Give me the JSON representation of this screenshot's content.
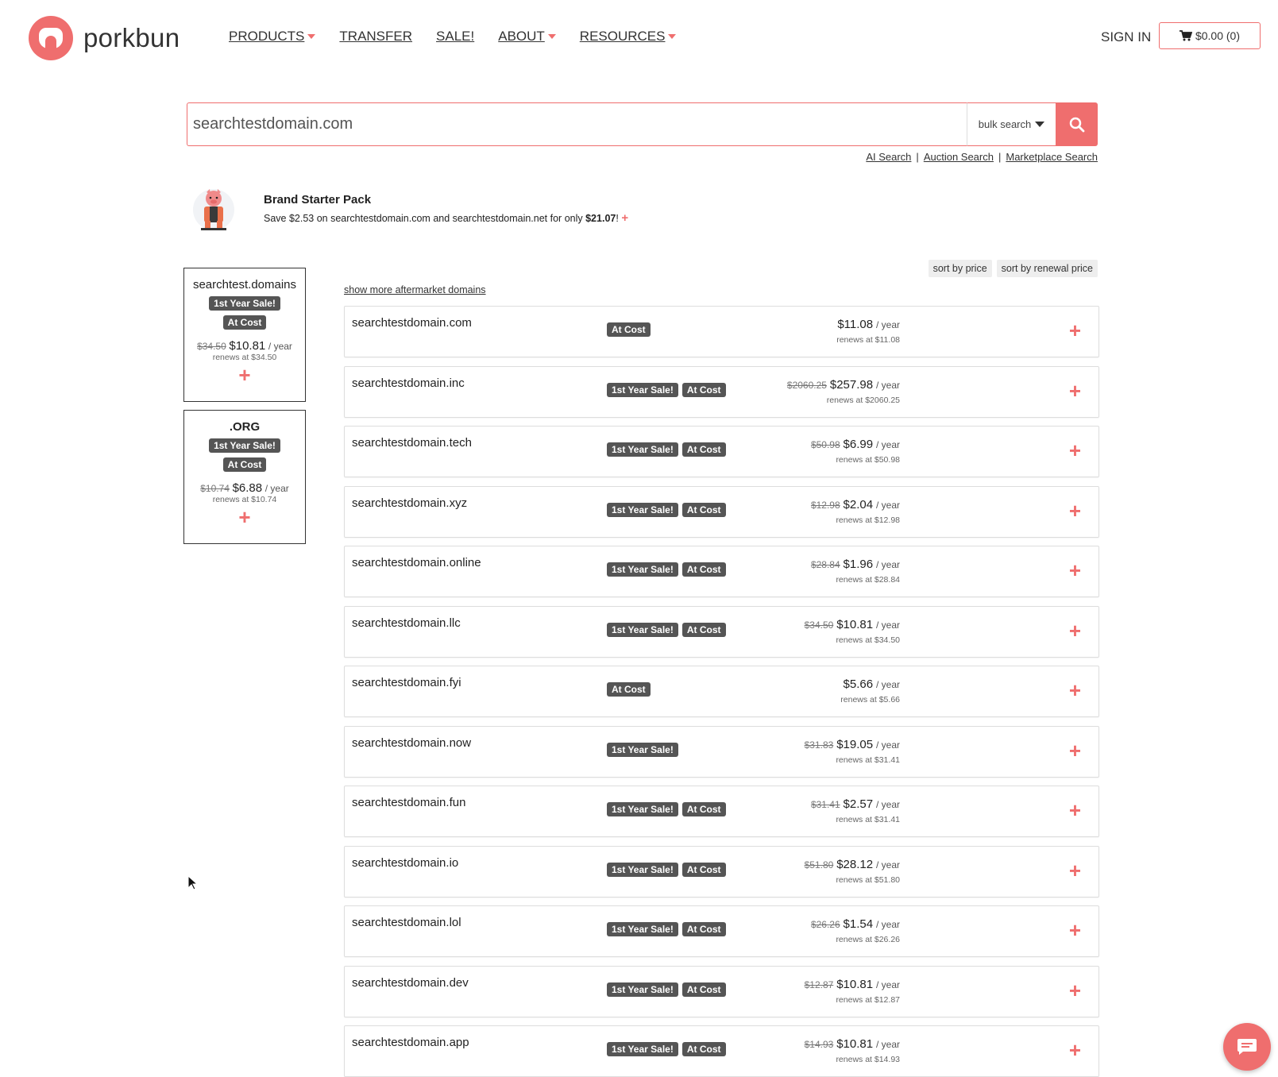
{
  "header": {
    "logo_text": "porkbun",
    "nav": [
      {
        "label": "PRODUCTS",
        "caret": true
      },
      {
        "label": "TRANSFER",
        "caret": false
      },
      {
        "label": "SALE!",
        "caret": false
      },
      {
        "label": "ABOUT",
        "caret": true
      },
      {
        "label": "RESOURCES",
        "caret": true
      }
    ],
    "sign_in": "SIGN IN",
    "cart": "$0.00 (0)"
  },
  "search": {
    "value": "searchtestdomain.com",
    "bulk_label": "bulk search",
    "links": [
      "AI Search",
      "Auction Search",
      "Marketplace Search"
    ],
    "separator": "|"
  },
  "brand_pack": {
    "title": "Brand Starter Pack",
    "desc_prefix": "Save $2.53 on searchtestdomain.com and searchtestdomain.net for only ",
    "price": "$21.07",
    "desc_suffix": "!",
    "plus": "+"
  },
  "sidebar": [
    {
      "name": "searchtest.domains",
      "badges": [
        "1st Year Sale!",
        "At Cost"
      ],
      "old_price": "$34.50",
      "price": "$10.81",
      "per": "/ year",
      "renews": "renews at $34.50",
      "plus": "+"
    },
    {
      "name": ".ORG",
      "badges": [
        "1st Year Sale!",
        "At Cost"
      ],
      "old_price": "$10.74",
      "price": "$6.88",
      "per": "/ year",
      "renews": "renews at $10.74",
      "plus": "+"
    }
  ],
  "sort": {
    "by_price": "sort by price",
    "by_renewal": "sort by renewal price"
  },
  "more_link": "show more aftermarket domains",
  "results": [
    {
      "domain": "searchtestdomain.com",
      "badges": [
        "At Cost"
      ],
      "old_price": "",
      "price": "$11.08",
      "per": "/ year",
      "renews": "renews at $11.08"
    },
    {
      "domain": "searchtestdomain.inc",
      "badges": [
        "1st Year Sale!",
        "At Cost"
      ],
      "old_price": "$2060.25",
      "price": "$257.98",
      "per": "/ year",
      "renews": "renews at $2060.25"
    },
    {
      "domain": "searchtestdomain.tech",
      "badges": [
        "1st Year Sale!",
        "At Cost"
      ],
      "old_price": "$50.98",
      "price": "$6.99",
      "per": "/ year",
      "renews": "renews at $50.98"
    },
    {
      "domain": "searchtestdomain.xyz",
      "badges": [
        "1st Year Sale!",
        "At Cost"
      ],
      "old_price": "$12.98",
      "price": "$2.04",
      "per": "/ year",
      "renews": "renews at $12.98"
    },
    {
      "domain": "searchtestdomain.online",
      "badges": [
        "1st Year Sale!",
        "At Cost"
      ],
      "old_price": "$28.84",
      "price": "$1.96",
      "per": "/ year",
      "renews": "renews at $28.84"
    },
    {
      "domain": "searchtestdomain.llc",
      "badges": [
        "1st Year Sale!",
        "At Cost"
      ],
      "old_price": "$34.50",
      "price": "$10.81",
      "per": "/ year",
      "renews": "renews at $34.50"
    },
    {
      "domain": "searchtestdomain.fyi",
      "badges": [
        "At Cost"
      ],
      "old_price": "",
      "price": "$5.66",
      "per": "/ year",
      "renews": "renews at $5.66"
    },
    {
      "domain": "searchtestdomain.now",
      "badges": [
        "1st Year Sale!"
      ],
      "old_price": "$31.83",
      "price": "$19.05",
      "per": "/ year",
      "renews": "renews at $31.41"
    },
    {
      "domain": "searchtestdomain.fun",
      "badges": [
        "1st Year Sale!",
        "At Cost"
      ],
      "old_price": "$31.41",
      "price": "$2.57",
      "per": "/ year",
      "renews": "renews at $31.41"
    },
    {
      "domain": "searchtestdomain.io",
      "badges": [
        "1st Year Sale!",
        "At Cost"
      ],
      "old_price": "$51.80",
      "price": "$28.12",
      "per": "/ year",
      "renews": "renews at $51.80"
    },
    {
      "domain": "searchtestdomain.lol",
      "badges": [
        "1st Year Sale!",
        "At Cost"
      ],
      "old_price": "$26.26",
      "price": "$1.54",
      "per": "/ year",
      "renews": "renews at $26.26"
    },
    {
      "domain": "searchtestdomain.dev",
      "badges": [
        "1st Year Sale!",
        "At Cost"
      ],
      "old_price": "$12.87",
      "price": "$10.81",
      "per": "/ year",
      "renews": "renews at $12.87"
    },
    {
      "domain": "searchtestdomain.app",
      "badges": [
        "1st Year Sale!",
        "At Cost"
      ],
      "old_price": "$14.93",
      "price": "$10.81",
      "per": "/ year",
      "renews": "renews at $14.93"
    }
  ],
  "add_symbol": "+",
  "colors": {
    "accent": "#ef6e6e",
    "badge_bg": "#555555",
    "text": "#222222"
  },
  "icons": {
    "cart": "cart-icon",
    "search": "search-icon",
    "chat": "chat-icon",
    "cursor": "mouse-cursor-icon"
  }
}
